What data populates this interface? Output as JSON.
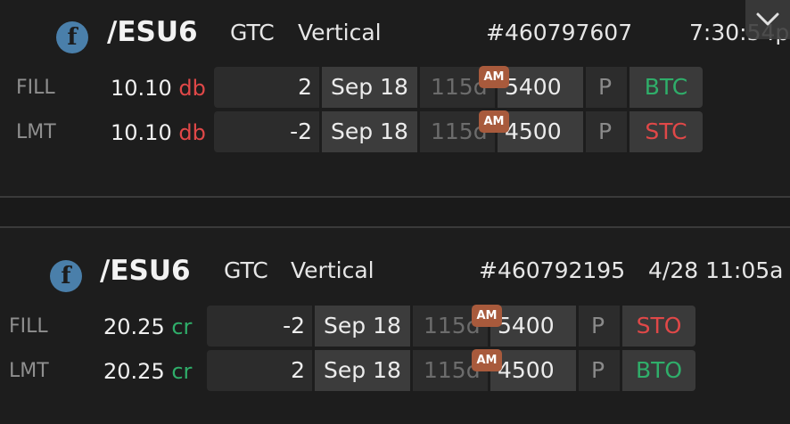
{
  "orders": [
    {
      "symbol": "/ESU6",
      "tif": "GTC",
      "strategy": "Vertical",
      "order_id": "#460797607",
      "time": "7:30:54p",
      "rows": [
        {
          "label": "FILL",
          "price": "10.10",
          "price_type": "db",
          "qty": "2",
          "date": "Sep 18",
          "days": "115d",
          "am": "AM",
          "strike": "5400",
          "pc": "P",
          "action": "BTC"
        },
        {
          "label": "LMT",
          "price": "10.10",
          "price_type": "db",
          "qty": "-2",
          "date": "Sep 18",
          "days": "115d",
          "am": "AM",
          "strike": "4500",
          "pc": "P",
          "action": "STC"
        }
      ]
    },
    {
      "symbol": "/ESU6",
      "tif": "GTC",
      "strategy": "Vertical",
      "order_id": "#460792195",
      "time": "4/28 11:05a",
      "rows": [
        {
          "label": "FILL",
          "price": "20.25",
          "price_type": "cr",
          "qty": "-2",
          "date": "Sep 18",
          "days": "115d",
          "am": "AM",
          "strike": "5400",
          "pc": "P",
          "action": "STO"
        },
        {
          "label": "LMT",
          "price": "20.25",
          "price_type": "cr",
          "qty": "2",
          "date": "Sep 18",
          "days": "115d",
          "am": "AM",
          "strike": "4500",
          "pc": "P",
          "action": "BTO"
        }
      ]
    }
  ],
  "icons": {
    "futures_badge": "f",
    "collapse": "chevron-down-icon"
  },
  "colors": {
    "debit": "#e04848",
    "credit": "#2fae6a",
    "am_badge": "#a85a3c",
    "futures_badge": "#4a7faa"
  }
}
